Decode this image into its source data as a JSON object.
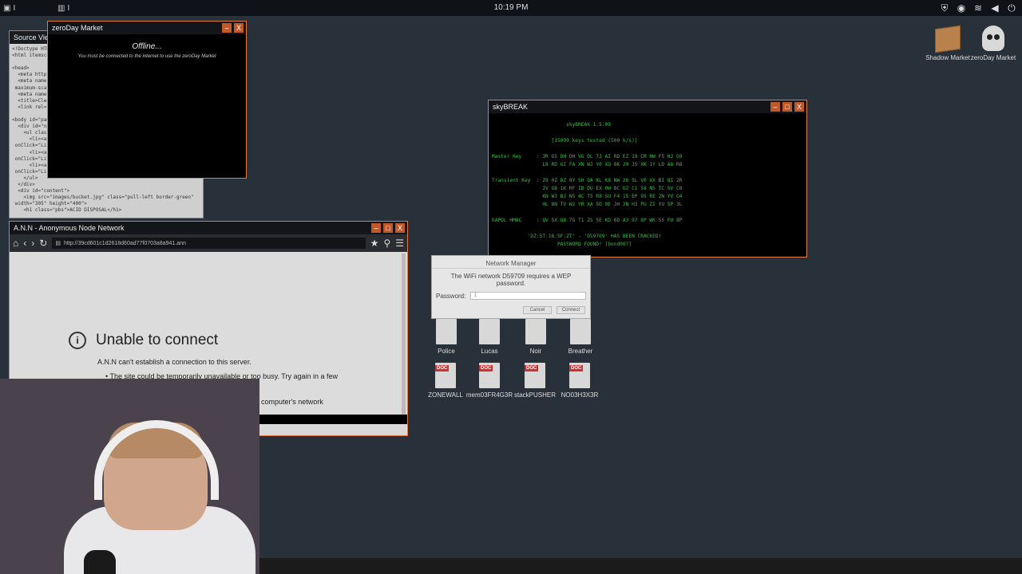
{
  "taskbar": {
    "clock": "10:19 PM",
    "btn1": "I",
    "btn2": "I"
  },
  "desktop": {
    "icons": [
      {
        "label": "Shadow Market",
        "icon": "package-icon"
      },
      {
        "label": "zeroDay Market",
        "icon": "skull-icon"
      }
    ],
    "doc_row1": [
      "Police",
      "Lucas",
      "Noir",
      "Breather"
    ],
    "doc_row2": [
      "ZONEWALL",
      "mem03FR4G3R",
      "stackPUSHER",
      "NO03H3X3R"
    ],
    "doc_tag": "DOC"
  },
  "source_viewer": {
    "title": "Source Viewer",
    "code": "<!Doctype HTML\n<html itemscop\n\n<head>\n  <meta http-e\n  <meta name\n maximum-scal\n  <meta name\n  <title>Clean\n  <link rel=\"st\n\n<body id=\"page\n  <div id=\"nav\n    <ul class=\n      <li><a\n onClick=\"LinkC\n      <li><a\n onClick=\"LinkC\n      <li><a\n onClick=\"LinkC\n    </ul>\n  </div>\n  <div id=\"content\">\n    <img src=\"images/bucket.jpg\" class=\"pull-left border-green\"\n width=\"305\" height=\"400\">\n    <h1 class=\"pbs\">ACID DISPOSAL</h1>"
  },
  "zeroday": {
    "title": "zeroDay Market",
    "offline": "Offline...",
    "message": "You must be connected to the internet to use the zeroDay Market"
  },
  "ann": {
    "title": "A.N.N - Anonymous Node Network",
    "url": "http://39cd601c1d2618d60ad77f0703a8a941.ann",
    "error_title": "Unable to connect",
    "error_text": "A.N.N can't establish a connection to this server.",
    "bullet1": "The site could be temporarily unavailable or too busy. Try again in a few",
    "partial": "computer's network"
  },
  "skybreak": {
    "title": "skyBREAK",
    "terminal": "                         skyBREAK 1.5.09\n\n                    [15099 keys tested (500 k/s)]\n\nMaster Key     : 3R G5 DH DH VG DL 7J AI RD EZ 19 CR NW F5 HJ G9\n                 L8 RD GI FA XN WJ Y0 XQ 8K 29 J5 XK 1Y LD A8 R8\n\nTransient Key  : Z8 0Z DZ 8Y SH QA KL K8 NW 26 5L V0 XX BI QI 2R\n                 2V GB 1K RF ID DU EX 0W BC U2 C1 58 N5 TC 5V C8\n                 KN W3 BJ N5 4C T5 R8 SU F4 15 EP 95 RE 2N YV G4\n                 HL 8N TV W2 YR XA 5D 9E JH 2N H3 PU ZI YU 5P 3L\n\nEAPOL HMAC     : QV SX Q8 7G T1 Z5 5E KD 6D A3 97 8P WK 55 FU 8P\n\n            'DZ:5T:18:5F:ZT' - 'D59709' HAS BEEN CRACKED!\n                      PASSWORD FOUND! [bond007]"
  },
  "network_manager": {
    "title": "Network Manager",
    "prompt": "The WiFi network D59709 requires a  WEP password.",
    "password_label": "Password:",
    "password_value": "1",
    "cancel": "Cancel",
    "connect": "Connect"
  }
}
